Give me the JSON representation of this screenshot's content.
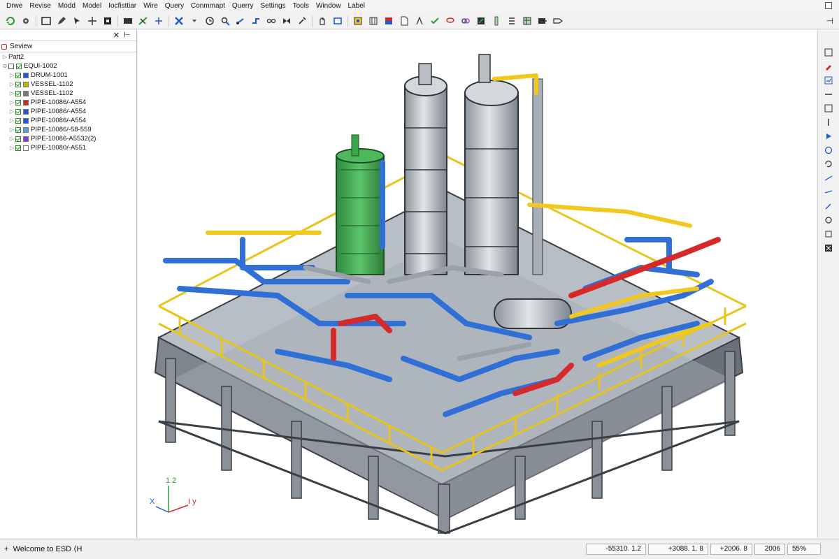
{
  "menu": [
    "Drwe",
    "Revise",
    "Modd",
    "Model",
    "Iocfisttiar",
    "Wire",
    "Query",
    "Conmmapt",
    "Querry",
    "Settings",
    "Tools",
    "Window",
    "Label"
  ],
  "tree": {
    "tab_label": "Seview",
    "root": "Patt2",
    "group": "EQUI-1002",
    "items": [
      {
        "label": "DRUM-1001",
        "type_color": "#1f5bd8"
      },
      {
        "label": "VESSEL-1102",
        "type_color": "#c8b400"
      },
      {
        "label": "VESSEL-1102",
        "type_color": "#7a7a7a"
      },
      {
        "label": "PIPE-10086/-A554",
        "type_color": "#d12a2a"
      },
      {
        "label": "PIPE-10086/-A554",
        "type_color": "#1f5bd8"
      },
      {
        "label": "PIPE-10086/-A554",
        "type_color": "#1f5bd8"
      },
      {
        "label": "PIPE-10086/-58-559",
        "type_color": "#5aa0e0"
      },
      {
        "label": "PIPE-10086-A5532(2)",
        "type_color": "#8a3ad0"
      },
      {
        "label": "PIPE-10080/-A551",
        "type_color": "#ffffff"
      }
    ]
  },
  "axes": {
    "z": "1 2",
    "x": "X",
    "y": "I y"
  },
  "status": {
    "message": "Welcome to ESD ⟨H",
    "x": "-55310. 1.2",
    "y": "+3088. 1. 8",
    "z": "+2006. 8",
    "field4": "2006",
    "zoom": "55%"
  },
  "colors": {
    "pipe_blue": "#2f6fd6",
    "pipe_yellow": "#f0c81e",
    "pipe_red": "#d62a2a",
    "steel": "#8c939c",
    "vessel_green": "#3aa84a"
  }
}
